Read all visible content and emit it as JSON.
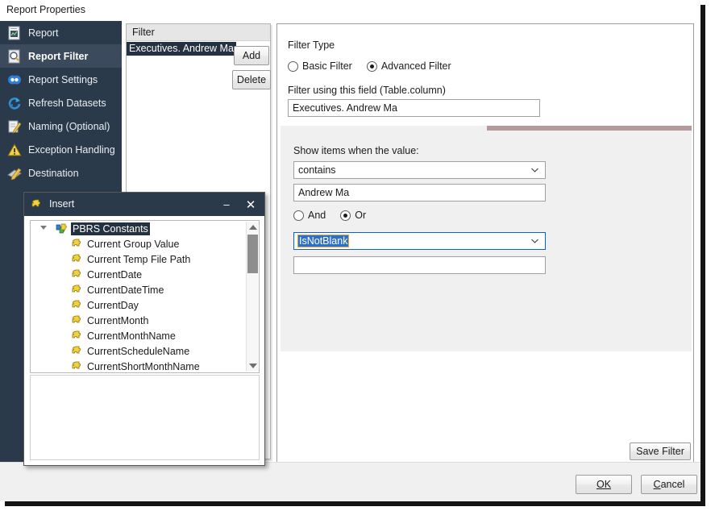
{
  "window": {
    "title": "Report Properties"
  },
  "sidebar": {
    "items": [
      {
        "label": "Report",
        "icon": "report-icon",
        "active": false
      },
      {
        "label": "Report Filter",
        "icon": "report-filter-icon",
        "active": true
      },
      {
        "label": "Report Settings",
        "icon": "report-settings-icon",
        "active": false
      },
      {
        "label": "Refresh Datasets",
        "icon": "refresh-datasets-icon",
        "active": false
      },
      {
        "label": "Naming (Optional)",
        "icon": "naming-icon",
        "active": false
      },
      {
        "label": "Exception Handling",
        "icon": "warning-icon",
        "active": false
      },
      {
        "label": "Destination",
        "icon": "destination-icon",
        "active": false
      }
    ],
    "scroll_down_icon": "chevron-down-icon"
  },
  "filter_list": {
    "header": "Filter",
    "items": [
      {
        "label": "Executives. Andrew Ma",
        "selected": true
      }
    ],
    "add_label": "Add",
    "delete_label": "Delete"
  },
  "detail": {
    "filter_type_label": "Filter Type",
    "filter_type_options": [
      {
        "label": "Basic Filter",
        "selected": false
      },
      {
        "label": "Advanced Filter",
        "selected": true
      }
    ],
    "field_label": "Filter using this field (Table.column)",
    "field_value": "Executives. Andrew Ma",
    "accent_color": "#b49a9a",
    "show_items_label": "Show items when the value:",
    "condition1_value": "contains",
    "value1": "Andrew Ma",
    "conjunction_options": [
      {
        "label": "And",
        "selected": false
      },
      {
        "label": "Or",
        "selected": true
      }
    ],
    "condition2_value": "IsNotBlank",
    "condition2_focused": true,
    "value2": "",
    "save_filter_label": "Save Filter"
  },
  "footer": {
    "ok_label": "OK",
    "ok_mnemonic": "O",
    "cancel_label": "Cancel",
    "cancel_mnemonic": "C"
  },
  "insert_dialog": {
    "title": "Insert",
    "title_icon": "puzzle-icon",
    "minimize_glyph": "–",
    "close_glyph": "✕",
    "tree": {
      "root": {
        "label": "PBRS Constants",
        "icon": "puzzle-multi-icon",
        "selected": true,
        "expanded": true
      },
      "children": [
        {
          "label": "Current Group Value",
          "icon": "puzzle-icon"
        },
        {
          "label": "Current Temp File Path",
          "icon": "puzzle-icon"
        },
        {
          "label": "CurrentDate",
          "icon": "puzzle-icon"
        },
        {
          "label": "CurrentDateTime",
          "icon": "puzzle-icon"
        },
        {
          "label": "CurrentDay",
          "icon": "puzzle-icon"
        },
        {
          "label": "CurrentMonth",
          "icon": "puzzle-icon"
        },
        {
          "label": "CurrentMonthName",
          "icon": "puzzle-icon"
        },
        {
          "label": "CurrentScheduleName",
          "icon": "puzzle-icon"
        },
        {
          "label": "CurrentShortMonthName",
          "icon": "puzzle-icon"
        }
      ]
    }
  }
}
